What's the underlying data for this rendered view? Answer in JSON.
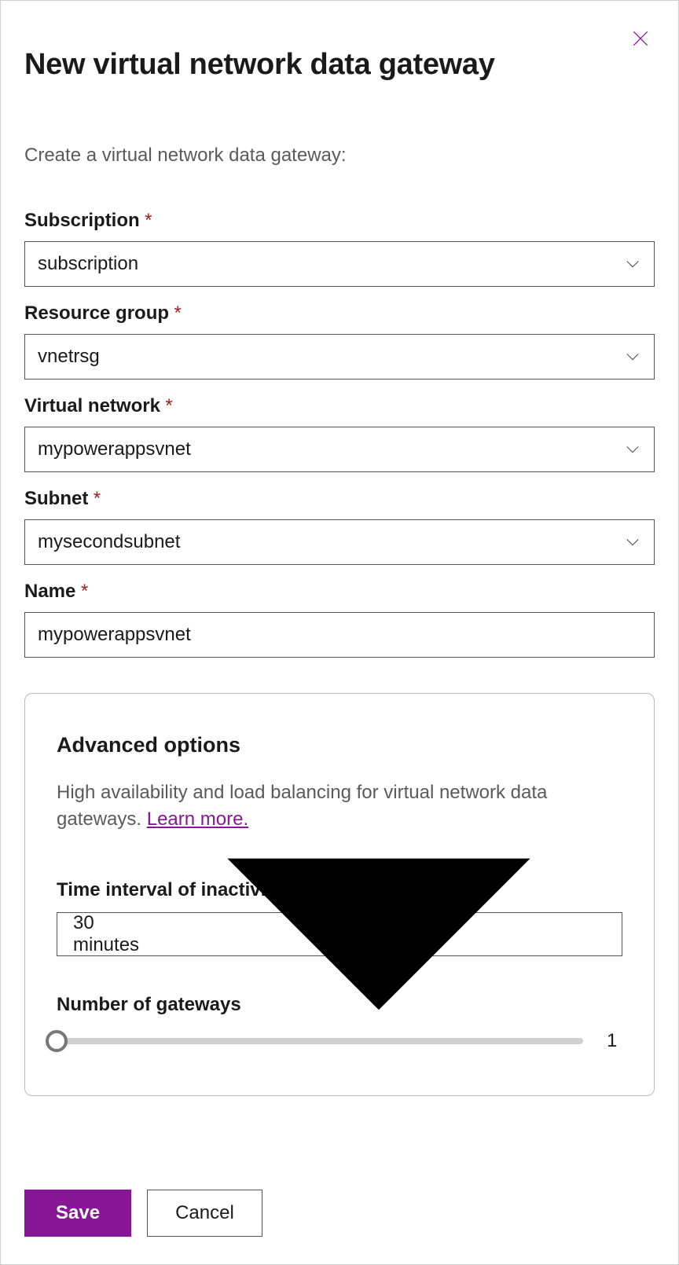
{
  "header": {
    "title": "New virtual network data gateway",
    "subtitle": "Create a virtual network data gateway:"
  },
  "fields": {
    "subscription": {
      "label": "Subscription",
      "value": "subscription"
    },
    "resource_group": {
      "label": "Resource group",
      "value": "vnetrsg"
    },
    "virtual_network": {
      "label": "Virtual network",
      "value": "mypowerappsvnet"
    },
    "subnet": {
      "label": "Subnet",
      "value": "mysecondsubnet"
    },
    "name": {
      "label": "Name",
      "value": "mypowerappsvnet"
    }
  },
  "advanced": {
    "title": "Advanced options",
    "description": "High availability and load balancing for virtual network data gateways. ",
    "learn_more": "Learn more.",
    "time_interval": {
      "label": "Time interval of inactivity before auto-pause",
      "value": "30 minutes"
    },
    "num_gateways": {
      "label": "Number of gateways",
      "value": "1"
    }
  },
  "footer": {
    "save": "Save",
    "cancel": "Cancel"
  },
  "required_marker": "*"
}
